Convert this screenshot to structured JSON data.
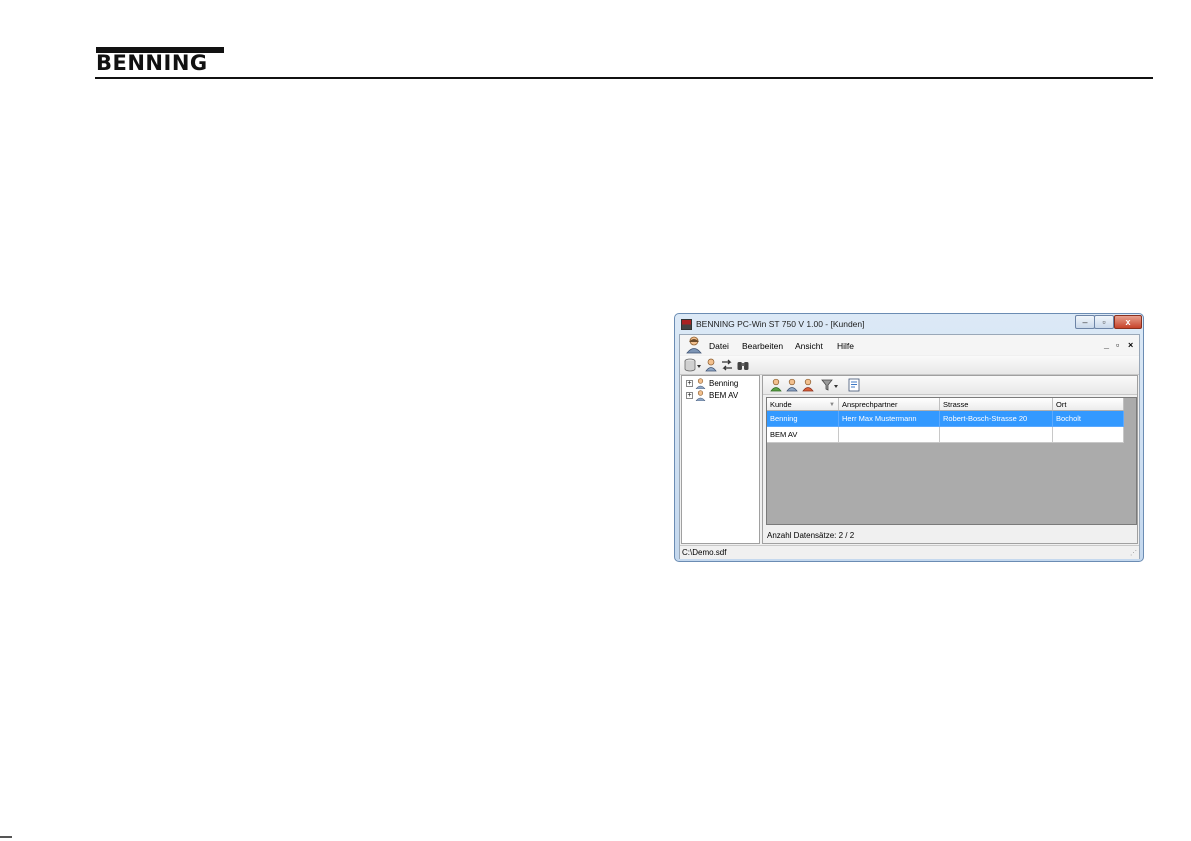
{
  "page": {
    "logo_text": "BENNING"
  },
  "window": {
    "title": "BENNING PC-Win ST 750 V 1.00 - [Kunden]",
    "caption": {
      "minimize": "–",
      "maximize": "▫",
      "close": "x"
    },
    "menu": [
      "Datei",
      "Bearbeiten",
      "Ansicht",
      "Hilfe"
    ],
    "mdi_controls": {
      "minimize": "_",
      "restore": "▫",
      "close": "×"
    },
    "toolbar_icons": [
      "database-icon",
      "person-icon",
      "transfer-icon",
      "binoculars-icon"
    ],
    "tree": {
      "items": [
        {
          "label": "Benning",
          "expander": "+"
        },
        {
          "label": "BEM AV",
          "expander": "+"
        }
      ]
    },
    "grid_toolbar_icons": [
      "add-customer-icon",
      "edit-customer-icon",
      "delete-customer-icon",
      "filter-icon",
      "report-icon"
    ],
    "grid": {
      "columns": [
        "Kunde",
        "Ansprechpartner",
        "Strasse",
        "Ort"
      ],
      "rows": [
        [
          "Benning",
          "Herr Max Mustermann",
          "Robert-Bosch-Strasse 20",
          "Bocholt"
        ],
        [
          "BEM AV",
          "",
          "",
          ""
        ]
      ],
      "selected_row": 0
    },
    "record_count": "Anzahl Datensätze: 2 / 2",
    "status": "C:\\Demo.sdf"
  },
  "colors": {
    "selection": "#3399ff",
    "grid_background": "#ababab",
    "title_gradient": "#dce9f6"
  }
}
